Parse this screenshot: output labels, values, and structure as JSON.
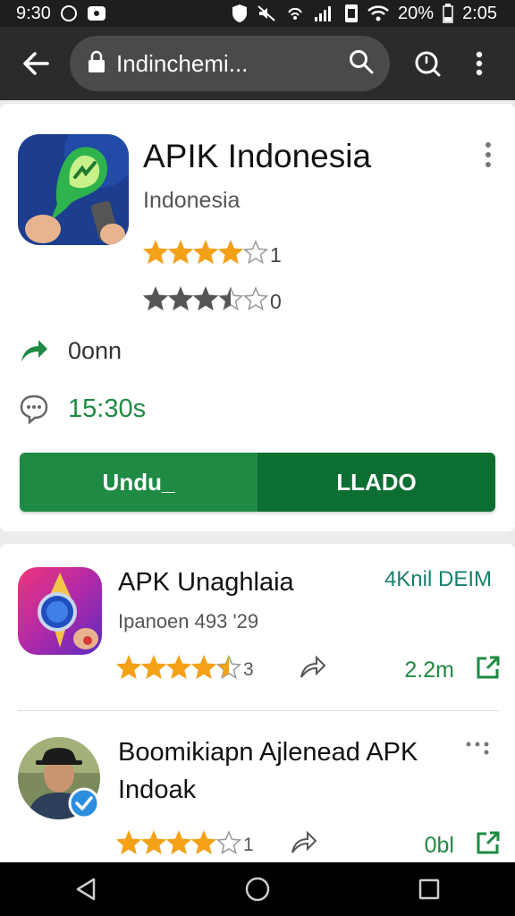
{
  "status_bar": {
    "time_left": "9:30",
    "battery": "20%",
    "time_right": "2:05"
  },
  "browser": {
    "url": "Indinchemi..."
  },
  "app": {
    "title": "APIK Indonesia",
    "developer": "Indonesia",
    "rating1_count": "1",
    "rating1_value": 4,
    "rating2_count": "0",
    "rating2_value": 3.5,
    "info1": "0onn",
    "info2": "15:30s",
    "download_label": "Undu_",
    "load_label": "LLADO"
  },
  "list": [
    {
      "title": "APK Unaghlaia",
      "subtitle": "Ipanoen 493 '29",
      "size_top": "4Knil DEIM",
      "rating_count": "3",
      "rating_value": 4.5,
      "size": "2.2m"
    },
    {
      "title": "Boomikiapn Ajlenead APK Indoak",
      "rating_count": "1",
      "rating_value": 4,
      "size": "0bl"
    }
  ],
  "colors": {
    "star": "#f4a118",
    "green": "#1e8a43",
    "dark_green": "#0d6e32",
    "teal": "#17806e"
  }
}
